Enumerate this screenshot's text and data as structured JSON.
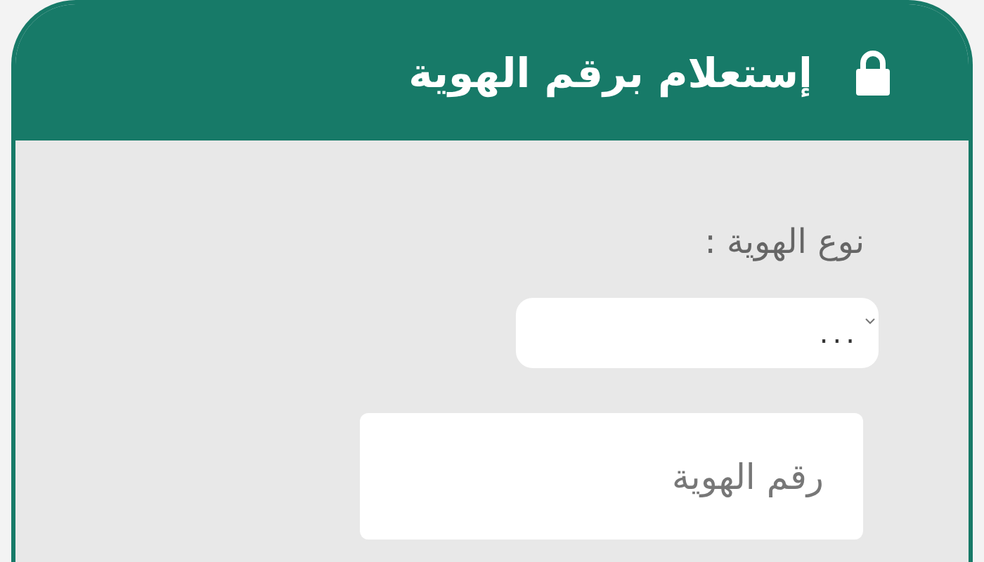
{
  "header": {
    "title": "إستعلام برقم الهوية"
  },
  "form": {
    "id_type_label": "نوع الهوية :",
    "id_type_select": {
      "value": "..."
    },
    "id_number_field": {
      "placeholder": "رقم الهوية"
    }
  }
}
